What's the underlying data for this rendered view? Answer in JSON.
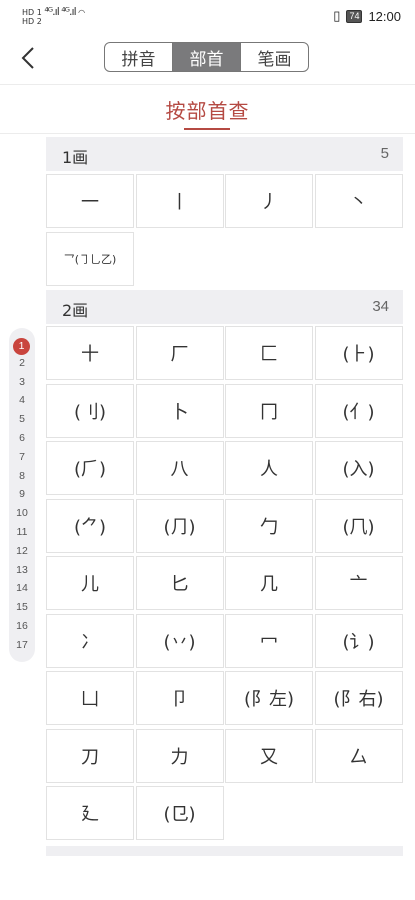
{
  "status": {
    "carrier1": "HD 1",
    "carrier2": "HD 2",
    "signal": "⁴ᴳ.ıl ⁴ᴳ.ıl",
    "battery": "74",
    "time": "12:00"
  },
  "tabs": [
    "拼音",
    "部首",
    "笔画"
  ],
  "page_title": "按部首查",
  "index": [
    "1",
    "2",
    "3",
    "4",
    "5",
    "6",
    "7",
    "8",
    "9",
    "10",
    "11",
    "12",
    "13",
    "14",
    "15",
    "16",
    "17"
  ],
  "sections": [
    {
      "title": "1画",
      "count": "5",
      "items": [
        "一",
        "丨",
        "丿",
        "丶",
        "乛(㇆乚乙)"
      ]
    },
    {
      "title": "2画",
      "count": "34",
      "items": [
        "十",
        "厂",
        "匚",
        "(⺊)",
        "(刂)",
        "卜",
        "冂",
        "(亻)",
        "(⺁)",
        "八",
        "人",
        "(入)",
        "(⺈)",
        "(⺆)",
        "勹",
        "(⺇)",
        "儿",
        "匕",
        "几",
        "亠",
        "冫",
        "(丷)",
        "冖",
        "(讠)",
        "凵",
        "卩",
        "(阝左)",
        "(阝右)",
        "刀",
        "力",
        "又",
        "厶",
        "廴",
        "(㔾)"
      ]
    }
  ]
}
